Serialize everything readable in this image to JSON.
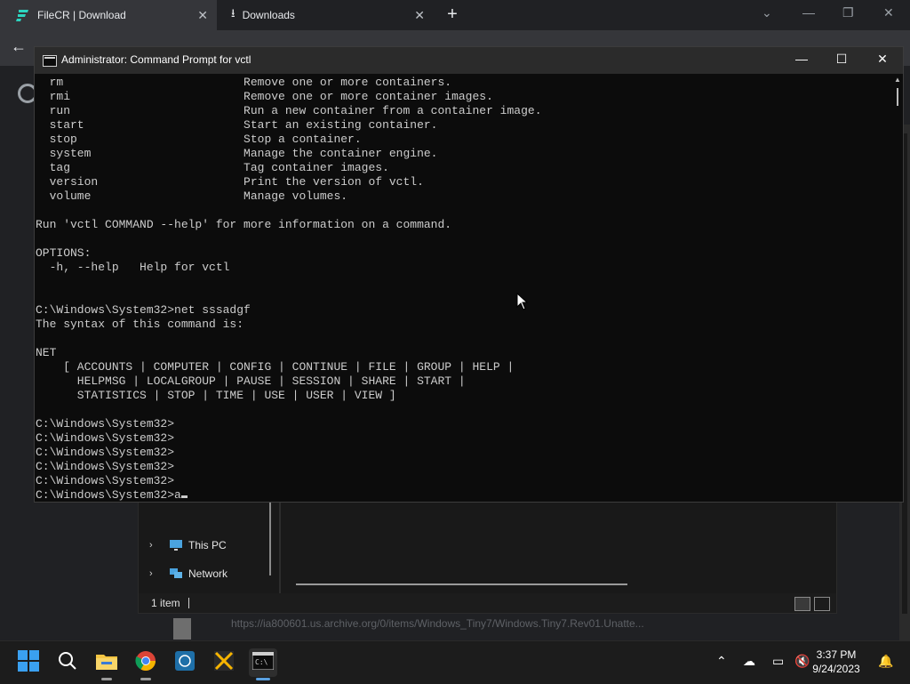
{
  "browser": {
    "tabs": [
      {
        "label": "FileCR | Download"
      },
      {
        "label": "Downloads"
      }
    ],
    "new_tab_label": "+",
    "status_url": "https://ia800601.us.archive.org/0/items/Windows_Tiny7/Windows.Tiny7.Rev01.Unatte..."
  },
  "explorer": {
    "nav_items": [
      {
        "label": "This PC"
      },
      {
        "label": "Network"
      }
    ],
    "status": "1 item"
  },
  "cmd": {
    "title": "Administrator: Command Prompt for vctl",
    "output": "  rm                          Remove one or more containers.\n  rmi                         Remove one or more container images.\n  run                         Run a new container from a container image.\n  start                       Start an existing container.\n  stop                        Stop a container.\n  system                      Manage the container engine.\n  tag                         Tag container images.\n  version                     Print the version of vctl.\n  volume                      Manage volumes.\n\nRun 'vctl COMMAND --help' for more information on a command.\n\nOPTIONS:\n  -h, --help   Help for vctl\n\n\nC:\\Windows\\System32>net sssadgf\nThe syntax of this command is:\n\nNET\n    [ ACCOUNTS | COMPUTER | CONFIG | CONTINUE | FILE | GROUP | HELP |\n      HELPMSG | LOCALGROUP | PAUSE | SESSION | SHARE | START |\n      STATISTICS | STOP | TIME | USE | USER | VIEW ]\n\nC:\\Windows\\System32>\nC:\\Windows\\System32>\nC:\\Windows\\System32>\nC:\\Windows\\System32>\nC:\\Windows\\System32>\nC:\\Windows\\System32>a"
  },
  "taskbar": {
    "time": "3:37 PM",
    "date": "9/24/2023"
  },
  "colors": {
    "terminal_bg": "#0c0c0c",
    "terminal_fg": "#cccccc",
    "taskbar_bg": "#1c1c1c",
    "chrome_tab_active": "#35363a"
  }
}
